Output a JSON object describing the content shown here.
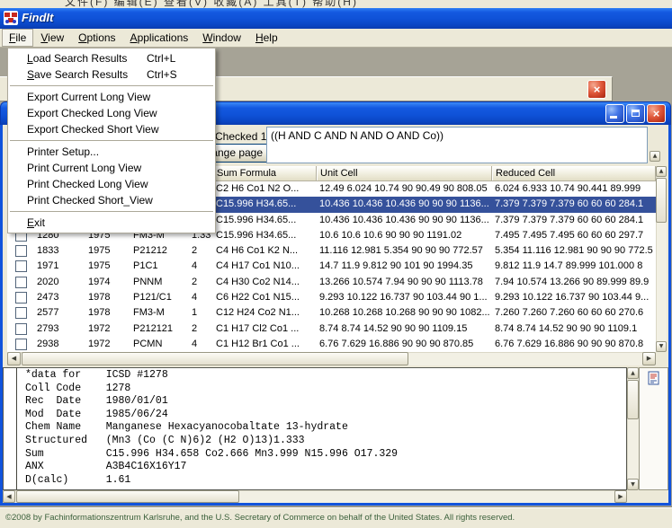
{
  "desktop": {
    "background_menu_text": "文件(F)  编辑(E)  查看(V)  收藏(A)  工具(T)  帮助(H)"
  },
  "window": {
    "title": "FindIt",
    "menu_items": [
      {
        "key": "F",
        "rest": "ile",
        "open": true
      },
      {
        "key": "V",
        "rest": "iew",
        "open": false
      },
      {
        "key": "O",
        "rest": "ptions",
        "open": false
      },
      {
        "key": "A",
        "rest": "pplications",
        "open": false
      },
      {
        "key": "W",
        "rest": "indow",
        "open": false
      },
      {
        "key": "H",
        "rest": "elp",
        "open": false
      }
    ],
    "status": "©2008 by Fachinformationszentrum Karlsruhe, and the U.S. Secretary of Commerce on behalf of the United States.  All rights reserved."
  },
  "file_menu": [
    {
      "pre": "",
      "key": "L",
      "post": "oad Search Results",
      "shortcut": "Ctrl+L"
    },
    {
      "pre": "",
      "key": "S",
      "post": "ave Search Results",
      "shortcut": "Ctrl+S"
    },
    {
      "sep": true
    },
    {
      "pre": "Export Current Long View",
      "key": "",
      "post": "",
      "shortcut": ""
    },
    {
      "pre": "Export Checked Long View",
      "key": "",
      "post": "",
      "shortcut": ""
    },
    {
      "pre": "Export Checked Short View",
      "key": "",
      "post": "",
      "shortcut": ""
    },
    {
      "sep": true
    },
    {
      "pre": "Printer Setup...",
      "key": "",
      "post": "",
      "shortcut": ""
    },
    {
      "pre": "Print Current Long View",
      "key": "",
      "post": "",
      "shortcut": ""
    },
    {
      "pre": "Print Checked Long View",
      "key": "",
      "post": "",
      "shortcut": ""
    },
    {
      "pre": "Print Checked Short_View",
      "key": "",
      "post": "",
      "shortcut": ""
    },
    {
      "sep": true
    },
    {
      "pre": "",
      "key": "E",
      "post": "xit",
      "shortcut": ""
    }
  ],
  "results": {
    "checked_label": "Checked 1",
    "change_page_button": "Change page",
    "query": "((H AND C AND N AND O AND Co))",
    "columns": {
      "sum": "Sum Formula",
      "unit": "Unit Cell",
      "reduced": "Reduced Cell"
    },
    "selected_row": 1,
    "rows": [
      {
        "id": "",
        "year": "",
        "sg": "",
        "z": "",
        "sum": "C2 H6 Co1 N2 O...",
        "unit": "12.49 6.024 10.74 90 90.49 90 808.05",
        "reduced": "6.024 6.933 10.74 90.441 89.999"
      },
      {
        "id": "",
        "year": "",
        "sg": "",
        "z": "",
        "sum": "C15.996 H34.65...",
        "unit": "10.436 10.436 10.436 90 90 90 1136...",
        "reduced": "7.379 7.379 7.379 60 60 60 284.1"
      },
      {
        "id": "",
        "year": "",
        "sg": "",
        "z": "",
        "sum": "C15.996 H34.65...",
        "unit": "10.436 10.436 10.436 90 90 90 1136...",
        "reduced": "7.379 7.379 7.379 60 60 60 284.1"
      },
      {
        "id": "1280",
        "year": "1975",
        "sg": "FM3-M",
        "z": "1.33",
        "sum": "C15.996 H34.65...",
        "unit": "10.6 10.6 10.6 90 90 90 1191.02",
        "reduced": "7.495 7.495 7.495 60 60 60 297.7"
      },
      {
        "id": "1833",
        "year": "1975",
        "sg": "P21212",
        "z": "2",
        "sum": "C4 H6 Co1 K2 N...",
        "unit": "11.116 12.981 5.354 90 90 90 772.57",
        "reduced": "5.354 11.116 12.981 90 90 90 772.5"
      },
      {
        "id": "1971",
        "year": "1975",
        "sg": "P1C1",
        "z": "4",
        "sum": "C4 H17 Co1 N10...",
        "unit": "14.7 11.9 9.812 90 101 90 1994.35",
        "reduced": "9.812 11.9 14.7 89.999 101.000 8"
      },
      {
        "id": "2020",
        "year": "1974",
        "sg": "PNNM",
        "z": "2",
        "sum": "C4 H30 Co2 N14...",
        "unit": "13.266 10.574 7.94 90 90 90 1113.78",
        "reduced": "7.94 10.574 13.266 90 89.999 89.9"
      },
      {
        "id": "2473",
        "year": "1978",
        "sg": "P121/C1",
        "z": "4",
        "sum": "C6 H22 Co1 N15...",
        "unit": "9.293 10.122 16.737 90 103.44 90 1...",
        "reduced": "9.293 10.122 16.737 90 103.44 9..."
      },
      {
        "id": "2577",
        "year": "1978",
        "sg": "FM3-M",
        "z": "1",
        "sum": "C12 H24 Co2 N1...",
        "unit": "10.268 10.268 10.268 90 90 90 1082...",
        "reduced": "7.260 7.260 7.260 60 60 60 270.6"
      },
      {
        "id": "2793",
        "year": "1972",
        "sg": "P212121",
        "z": "2",
        "sum": "C1 H17 Cl2 Co1 ...",
        "unit": "8.74 8.74 14.52 90 90 90 1109.15",
        "reduced": "8.74 8.74 14.52 90 90 90 1109.1"
      },
      {
        "id": "2938",
        "year": "1972",
        "sg": "PCMN",
        "z": "4",
        "sum": "C1 H12 Br1 Co1 ...",
        "unit": "6.76 7.629 16.886 90 90 90 870.85",
        "reduced": "6.76 7.629 16.886 90 90 90 870.8"
      }
    ]
  },
  "detail": {
    "lines": [
      "*data for    ICSD #1278",
      "Coll Code    1278",
      "Rec  Date    1980/01/01",
      "Mod  Date    1985/06/24",
      "Chem Name    Manganese Hexacyanocobaltate 13-hydrate",
      "Structured   (Mn3 (Co (C N)6)2 (H2 O)13)1.333",
      "Sum          C15.996 H34.658 Co2.666 Mn3.999 N15.996 O17.329",
      "ANX          A3B4C16X16Y17",
      "D(calc)      1.61"
    ]
  },
  "scroll": {
    "up": "▲",
    "down": "▼",
    "left": "◀",
    "right": "▶"
  }
}
